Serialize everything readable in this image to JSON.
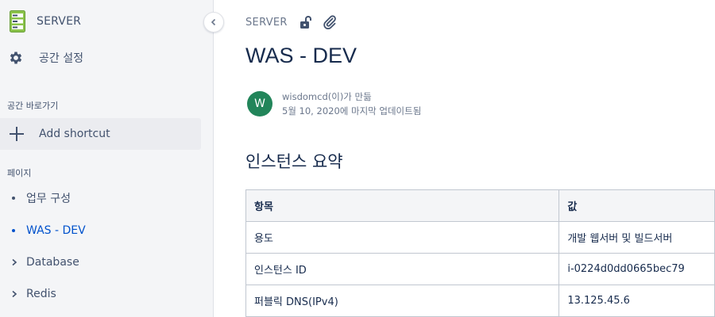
{
  "sidebar": {
    "space_name": "SERVER",
    "settings_label": "공간 설정",
    "shortcuts_title": "공간 바로가기",
    "add_shortcut_label": "Add shortcut",
    "pages_title": "페이지",
    "tree": [
      {
        "label": "업무 구성",
        "kind": "bullet",
        "active": false
      },
      {
        "label": "WAS - DEV",
        "kind": "bullet",
        "active": true
      },
      {
        "label": "Database",
        "kind": "chevron",
        "active": false
      },
      {
        "label": "Redis",
        "kind": "chevron",
        "active": false
      }
    ]
  },
  "breadcrumb": {
    "space": "SERVER"
  },
  "page": {
    "title": "WAS - DEV",
    "author_initial": "W",
    "created_by": "wisdomcd(이)가 만듦",
    "updated": "5월 10, 2020에 마지막 업데이트됨"
  },
  "content": {
    "section_heading": "인스턴스 요약",
    "table": {
      "headers": [
        "항목",
        "값"
      ],
      "rows": [
        [
          "용도",
          "개발 웹서버 및 빌드서버"
        ],
        [
          "인스턴스 ID",
          "i-0224d0dd0665bec79"
        ],
        [
          "퍼블릭 DNS(IPv4)",
          "13.125.45.6"
        ]
      ]
    }
  },
  "colors": {
    "sidebar_bg": "#f4f5f7",
    "active_link": "#0052cc",
    "avatar_bg": "#22855a",
    "space_icon": "#8bc34a"
  }
}
